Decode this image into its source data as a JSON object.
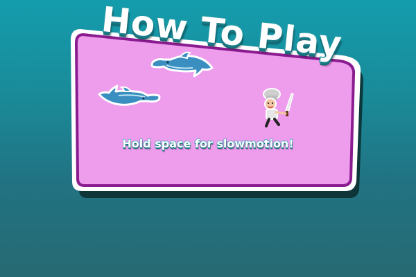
{
  "game": {
    "screen": "how-to-play",
    "title": "How To Play",
    "instruction": "Hold space for slowmotion!",
    "characters": [
      "dolphin",
      "dolphin",
      "chef-with-knife"
    ]
  },
  "colors": {
    "background_top": "#149cad",
    "background_bottom": "#266a73",
    "panel_fill": "#ee9cec",
    "panel_border": "#8a1c90",
    "panel_outline": "#ffffff",
    "title_fill": "#ffffff",
    "title_stroke": "#1e9aa6",
    "dolphin": "#3a8fc0"
  }
}
